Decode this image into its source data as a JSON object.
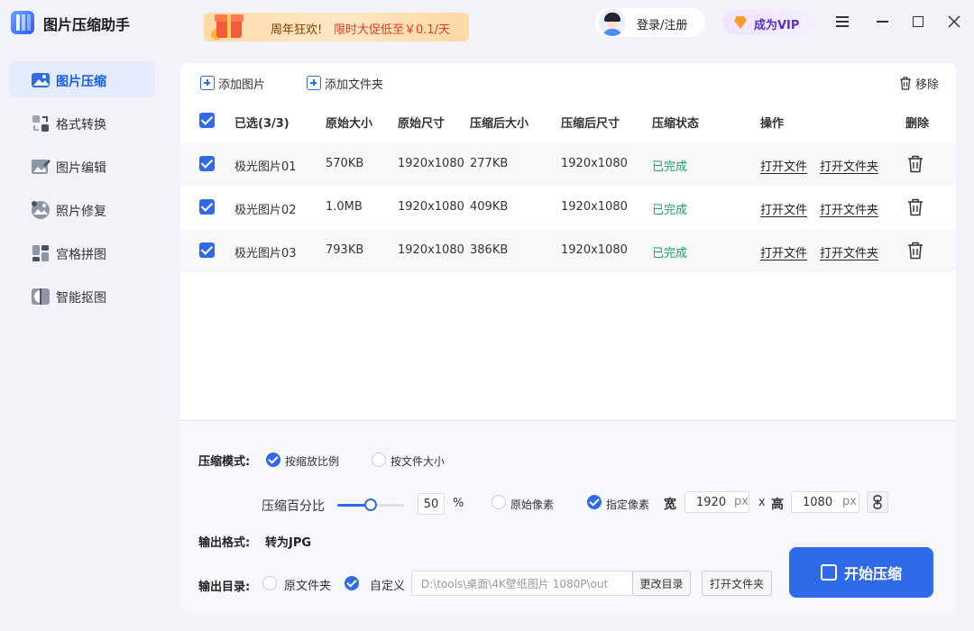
{
  "app": {
    "title": "图片压缩助手"
  },
  "promo": {
    "text1": "周年狂欢!",
    "text2": "限时大促低至￥0.1/天"
  },
  "header": {
    "login_label": "登录/注册",
    "vip_label": "成为VIP"
  },
  "sidebar": {
    "items": [
      {
        "label": "图片压缩",
        "icon": "image-compress-icon",
        "active": true
      },
      {
        "label": "格式转换",
        "icon": "format-convert-icon"
      },
      {
        "label": "图片编辑",
        "icon": "image-edit-icon"
      },
      {
        "label": "照片修复",
        "icon": "photo-repair-icon"
      },
      {
        "label": "宫格拼图",
        "icon": "grid-collage-icon"
      },
      {
        "label": "智能抠图",
        "icon": "smart-cutout-icon"
      }
    ]
  },
  "toolbar": {
    "add_image": "添加图片",
    "add_folder": "添加文件夹",
    "remove": "移除"
  },
  "table": {
    "headers": {
      "selected": "已选(3/3)",
      "orig_size": "原始大小",
      "orig_dim": "原始尺寸",
      "comp_size": "压缩后大小",
      "comp_dim": "压缩后尺寸",
      "status": "压缩状态",
      "action": "操作",
      "delete": "删除"
    },
    "rows": [
      {
        "name": "极光图片01",
        "orig_size": "570KB",
        "orig_dim": "1920x1080",
        "comp_size": "277KB",
        "comp_dim": "1920x1080",
        "status": "已完成",
        "open_file": "打开文件",
        "open_folder": "打开文件夹"
      },
      {
        "name": "极光图片02",
        "orig_size": "1.0MB",
        "orig_dim": "1920x1080",
        "comp_size": "409KB",
        "comp_dim": "1920x1080",
        "status": "已完成",
        "open_file": "打开文件",
        "open_folder": "打开文件夹"
      },
      {
        "name": "极光图片03",
        "orig_size": "793KB",
        "orig_dim": "1920x1080",
        "comp_size": "386KB",
        "comp_dim": "1920x1080",
        "status": "已完成",
        "open_file": "打开文件",
        "open_folder": "打开文件夹"
      }
    ]
  },
  "settings": {
    "mode_label": "压缩模式:",
    "mode_scale": "按缩放比例",
    "mode_filesize": "按文件大小",
    "percent_label": "压缩百分比",
    "percent_value": "50",
    "percent_unit": "%",
    "percent_fraction": 0.5,
    "orig_pixels": "原始像素",
    "custom_pixels": "指定像素",
    "width_label": "宽",
    "width_value": "1920",
    "height_label": "高",
    "height_value": "1080",
    "px_unit": "px",
    "times": "x",
    "format_label": "输出格式:",
    "format_value": "转为JPG",
    "dir_label": "输出目录:",
    "dir_original": "原文件夹",
    "dir_custom": "自定义",
    "dir_path": "D:\\tools\\桌面\\4K壁纸图片 1080P\\out",
    "change_dir": "更改目录",
    "open_folder": "打开文件夹",
    "start_button": "开始压缩"
  },
  "colors": {
    "accent": "#2f6ae8",
    "done": "#1ea25a",
    "active_bg": "#e4ebfb"
  }
}
